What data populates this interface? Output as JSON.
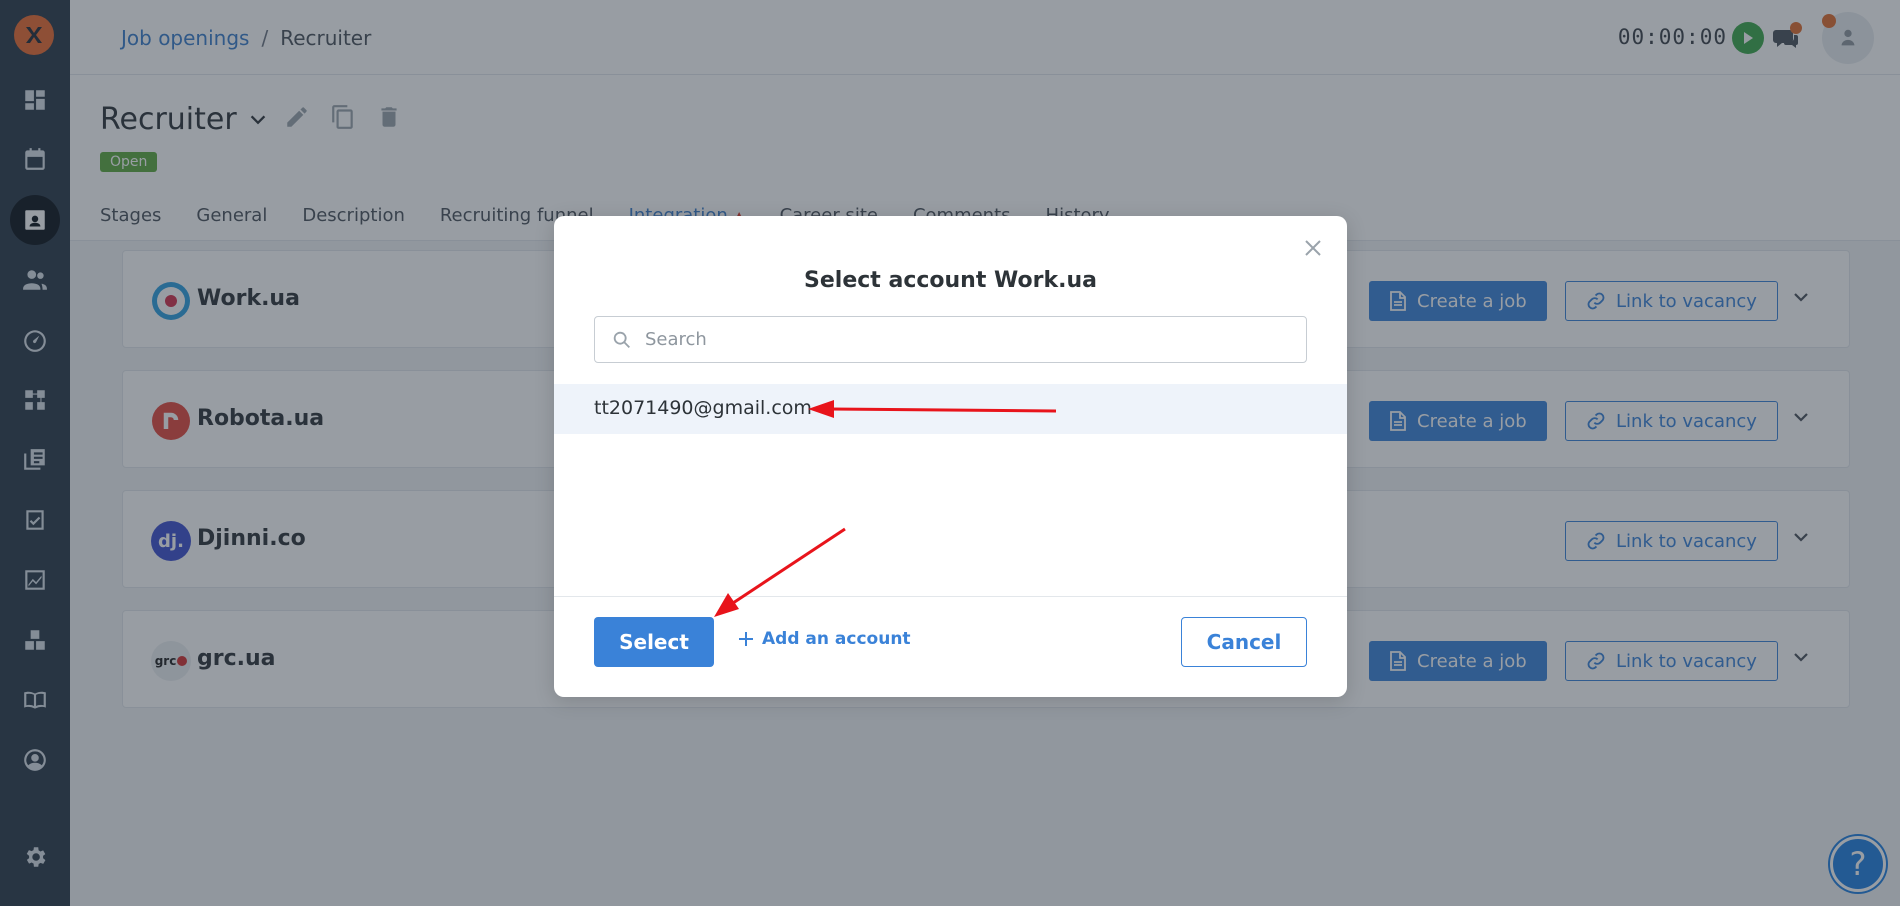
{
  "breadcrumb": {
    "parent": "Job openings",
    "separator": "/",
    "current": "Recruiter"
  },
  "header": {
    "timer": "00:00:00"
  },
  "job": {
    "title": "Recruiter",
    "status": "Open"
  },
  "tabs": [
    {
      "label": "Stages"
    },
    {
      "label": "General"
    },
    {
      "label": "Description"
    },
    {
      "label": "Recruiting funnel"
    },
    {
      "label": "Integration"
    },
    {
      "label": "Career site"
    },
    {
      "label": "Comments"
    },
    {
      "label": "History"
    }
  ],
  "integrations": [
    {
      "name": "Work.ua",
      "create_label": "Create a job",
      "link_label": "Link to vacancy"
    },
    {
      "name": "Robota.ua",
      "create_label": "Create a job",
      "link_label": "Link to vacancy"
    },
    {
      "name": "Djinni.co",
      "link_label": "Link to vacancy"
    },
    {
      "name": "grc.ua",
      "create_label": "Create a job",
      "link_label": "Link to vacancy"
    }
  ],
  "logos": {
    "djinni": "dj.",
    "grc": "grc"
  },
  "modal": {
    "title": "Select account Work.ua",
    "search_placeholder": "Search",
    "accounts": [
      "tt2071490@gmail.com"
    ],
    "select_label": "Select",
    "add_account_label": "Add an account",
    "cancel_label": "Cancel"
  },
  "help": {
    "label": "?"
  },
  "colors": {
    "accent": "#3a82d8",
    "sidebar": "#2a3847",
    "status_open": "#5daa3f",
    "brand": "#ec6a2e",
    "annotation": "#e8141b"
  }
}
